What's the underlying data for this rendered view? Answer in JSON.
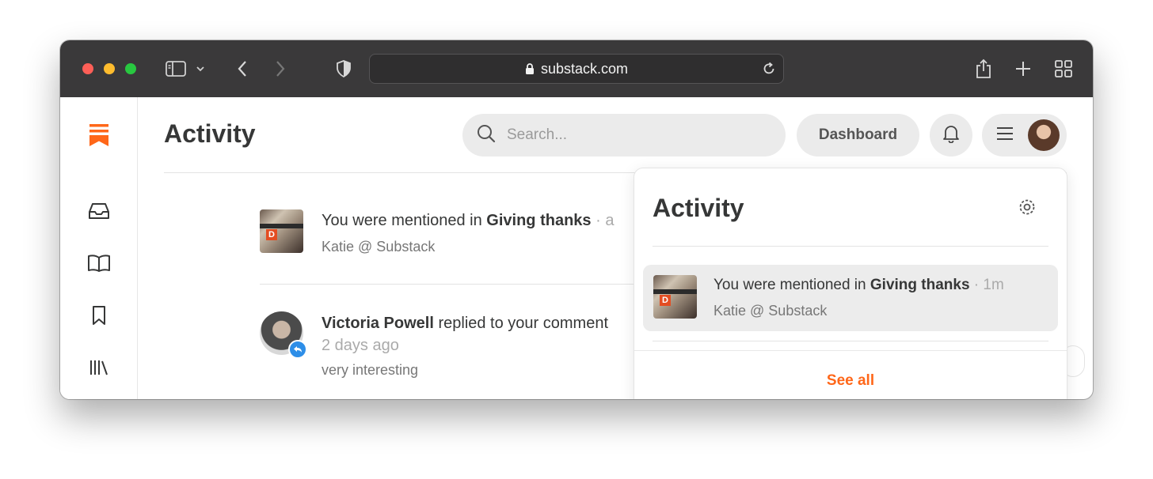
{
  "browser": {
    "url": "substack.com",
    "icons": [
      "sidebar-toggle-icon",
      "chevron-down-icon",
      "back-arrow-icon",
      "forward-arrow-icon",
      "shield-icon",
      "lock-icon",
      "reload-icon",
      "share-icon",
      "new-tab-icon",
      "tab-overview-icon"
    ]
  },
  "sidebar": {
    "icons": [
      "substack-logo-icon",
      "inbox-icon",
      "book-open-icon",
      "bookmark-icon",
      "library-icon"
    ]
  },
  "header": {
    "title": "Activity",
    "search_placeholder": "Search...",
    "dashboard_label": "Dashboard"
  },
  "feed": [
    {
      "prefix": "You were mentioned in ",
      "post": "Giving thanks",
      "sep": " · a",
      "sub": "Katie @ Substack"
    },
    {
      "name": "Victoria Powell",
      "action": " replied to your comment",
      "time": "2 days ago",
      "sub": "very interesting"
    }
  ],
  "panel": {
    "title": "Activity",
    "item": {
      "prefix": "You were mentioned in ",
      "post": "Giving thanks",
      "sep": " · ",
      "time": "1m",
      "sub": "Katie @ Substack"
    },
    "see_all": "See all"
  },
  "colors": {
    "accent": "#ff6719",
    "titlebar": "#3a393a",
    "reply_badge": "#2d8ee8"
  }
}
